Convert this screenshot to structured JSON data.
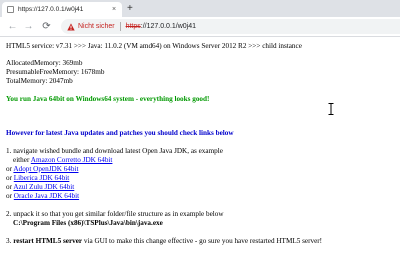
{
  "browser": {
    "tab_title": "https://127.0.0.1/w0j41",
    "tab_close": "×",
    "new_tab": "+",
    "back": "←",
    "forward": "→",
    "reload": "⟳",
    "security_label": "Nicht sicher",
    "url_scheme": "https",
    "url_rest": "://127.0.0.1/w0j41"
  },
  "page": {
    "version_line": "HTML5 service: v7.31 >>> Java: 11.0.2 (VM amd64) on Windows Server 2012 R2 >>> child instance",
    "memory": [
      "AllocatedMemory: 369mb",
      "PresumableFreeMemory: 1678mb",
      "TotalMemory: 2047mb"
    ],
    "java_status": "You run Java 64bit on Windows64 system - everything looks good!",
    "updates_heading": "However for latest Java updates and patches you should check links below",
    "step1_text": "1. navigate wished bundle and download latest Open Java JDK, as example",
    "links": [
      {
        "prefix": "either",
        "label": "Amazon Corretto JDK 64bit"
      },
      {
        "prefix": "or",
        "label": "Adopt OpenJDK 64bit"
      },
      {
        "prefix": "or",
        "label": "Liberica JDK 64bit"
      },
      {
        "prefix": "or",
        "label": "Azul Zulu JDK 64bit"
      },
      {
        "prefix": "or",
        "label": "Oracle Java JDK 64bit"
      }
    ],
    "step2_text": "2. unpack it so that you get similar folder/file structure as in example below",
    "java_path": "C:\\Program Files (x86)\\TSPlus\\Java\\bin\\java.exe",
    "step3_prefix": "3. ",
    "step3_bold": "restart HTML5 server",
    "step3_rest": " via GUI to make this change effective - go sure you have restarted HTML5 server!"
  },
  "icons": {
    "favicon": "page-icon",
    "warning": "warning-triangle-icon",
    "cursor": "text-cursor-icon"
  },
  "colors": {
    "status_green": "#009900",
    "heading_blue": "#0000cc",
    "link_blue": "#0000ee",
    "insecure_red": "#c5221f"
  }
}
